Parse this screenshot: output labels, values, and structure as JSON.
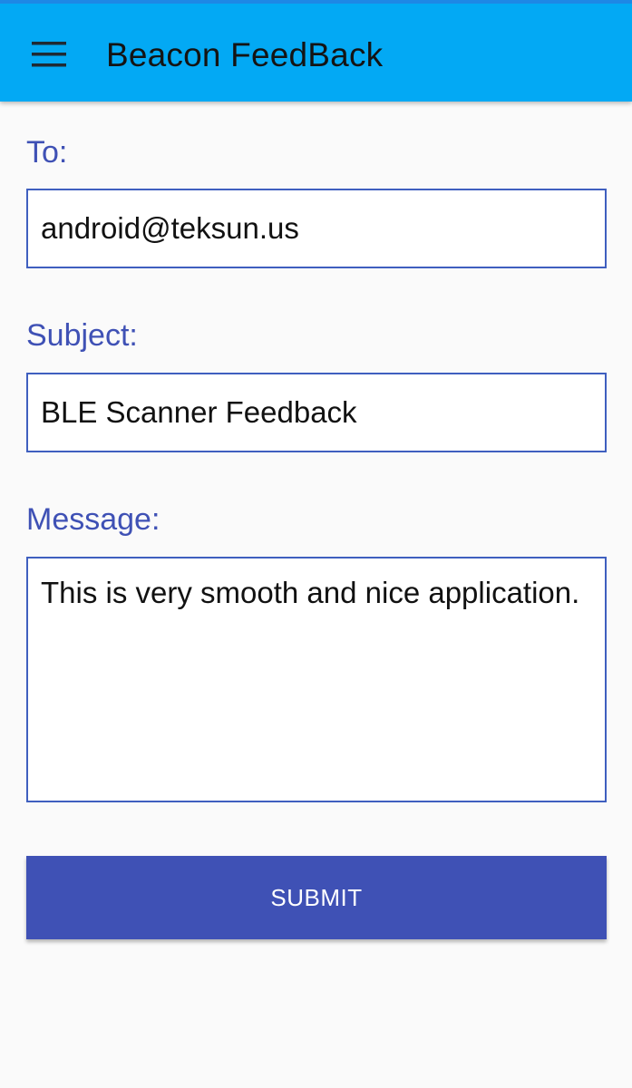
{
  "app_bar": {
    "menu_icon": "hamburger-menu-icon",
    "title": "Beacon FeedBack",
    "background_color": "#03a9f4"
  },
  "form": {
    "to": {
      "label": "To:",
      "value": "android@teksun.us"
    },
    "subject": {
      "label": "Subject:",
      "value": "BLE Scanner Feedback"
    },
    "message": {
      "label": "Message:",
      "value": "This is very smooth and nice application."
    },
    "submit_label": "SUBMIT",
    "accent_color": "#3f51b5"
  }
}
